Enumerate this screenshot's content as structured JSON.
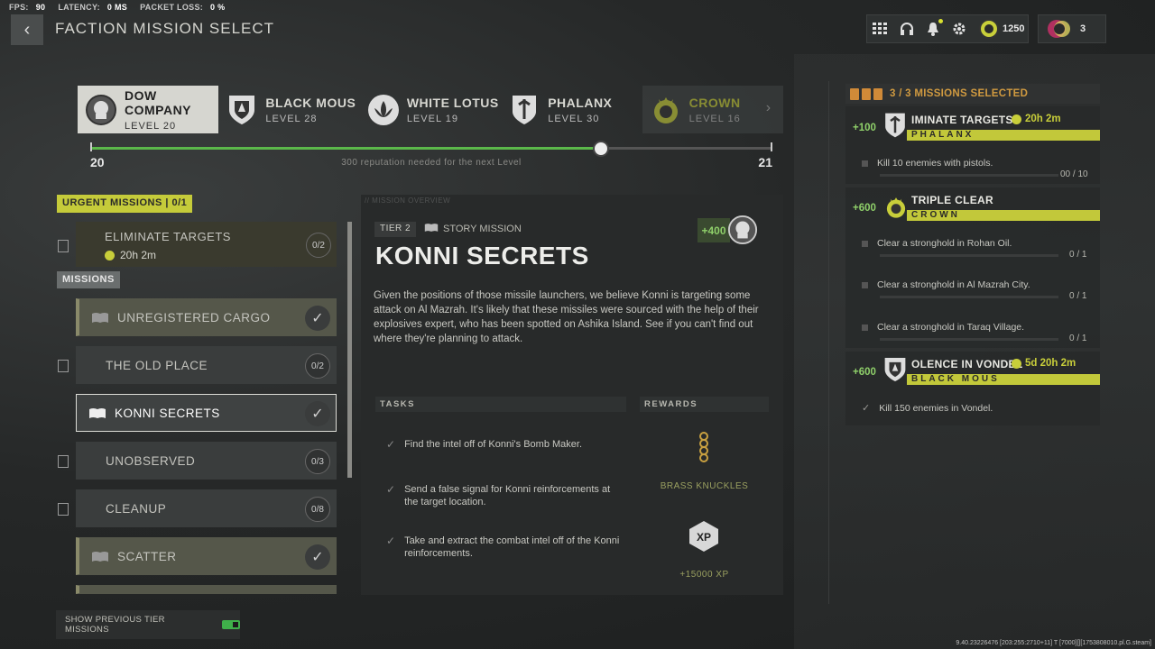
{
  "stats": {
    "fps_label": "FPS:",
    "fps": "90",
    "latency_label": "LATENCY:",
    "latency": "0 MS",
    "packet_label": "PACKET LOSS:",
    "packet": "0 %"
  },
  "header": {
    "title": "FACTION MISSION SELECT",
    "cp": "1250",
    "players": "3"
  },
  "factions": [
    {
      "name": "DOW COMPANY",
      "level": "LEVEL 20"
    },
    {
      "name": "BLACK MOUS",
      "level": "LEVEL 28"
    },
    {
      "name": "WHITE LOTUS",
      "level": "LEVEL 19"
    },
    {
      "name": "PHALANX",
      "level": "LEVEL 30"
    },
    {
      "name": "CROWN",
      "level": "LEVEL 16"
    }
  ],
  "reputation": {
    "current": "20",
    "next": "21",
    "message": "300 reputation needed for the next Level",
    "progress": 0.75
  },
  "urgent": {
    "header": "URGENT MISSIONS | 0/1",
    "mission": "ELIMINATE TARGETS",
    "time": "20h 2m",
    "count": "0/2"
  },
  "missions_header": "MISSIONS",
  "missions": [
    {
      "label": "UNREGISTERED CARGO",
      "count": ""
    },
    {
      "label": "THE OLD PLACE",
      "count": "0/2"
    },
    {
      "label": "KONNI SECRETS",
      "count": ""
    },
    {
      "label": "UNOBSERVED",
      "count": "0/3"
    },
    {
      "label": "CLEANUP",
      "count": "0/8"
    },
    {
      "label": "SCATTER",
      "count": ""
    }
  ],
  "overview": {
    "section_label": "// MISSION OVERVIEW",
    "tier": "TIER 2",
    "type": "STORY MISSION",
    "xp": "+400",
    "title": "KONNI SECRETS",
    "description": "Given the positions of those missile launchers, we believe Konni is targeting some attack on Al Mazrah. It's likely that these missiles were sourced with the help of their explosives expert, who has been spotted on Ashika Island. See if you can't find out where they're planning to attack.",
    "tasks_header": "TASKS",
    "rewards_header": "REWARDS",
    "tasks": [
      "Find the intel off of Konni's Bomb Maker.",
      "Send a false signal for Konni reinforcements at the target location.",
      "Take and extract the combat intel off of the Konni reinforcements."
    ],
    "rewards": [
      "BRASS KNUCKLES",
      "+15000 XP"
    ]
  },
  "selected": {
    "header": "3 / 3 MISSIONS SELECTED",
    "cards": [
      {
        "points": "+100",
        "name": "IMINATE TARGETS",
        "time": "20h 2m",
        "faction": "PHALANX",
        "objectives": [
          {
            "text": "Kill 10 enemies with pistols.",
            "progress": "00 / 10"
          }
        ]
      },
      {
        "points": "+600",
        "name": "TRIPLE CLEAR",
        "time": "",
        "faction": "CROWN",
        "objectives": [
          {
            "text": "Clear a stronghold in Rohan Oil.",
            "progress": "0 / 1"
          },
          {
            "text": "Clear a stronghold in Al Mazrah City.",
            "progress": "0 / 1"
          },
          {
            "text": "Clear a stronghold in Taraq Village.",
            "progress": "0 / 1"
          }
        ]
      },
      {
        "points": "+600",
        "name": "OLENCE IN VONDEL",
        "time": "5d 20h 2m",
        "faction": "BLACK MOUS",
        "objectives": [
          {
            "text": "Kill 150 enemies in Vondel.",
            "progress": ""
          }
        ]
      }
    ]
  },
  "footer": {
    "toggle_label": "SHOW PREVIOUS TIER MISSIONS",
    "build": "9.40.23226476 [203:255:2710+11] T [7000][][1753808010.pl.G.steam]"
  }
}
